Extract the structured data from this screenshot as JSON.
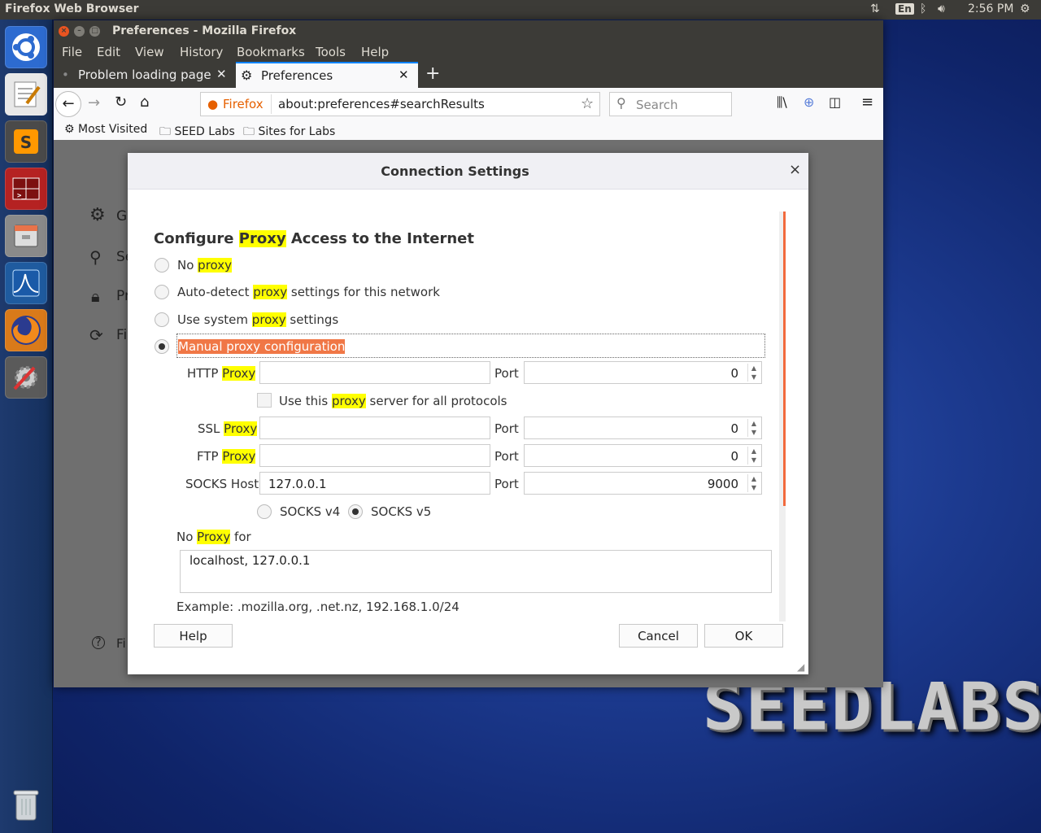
{
  "top_panel": {
    "title": "Firefox Web Browser",
    "keyboard_layout": "En",
    "time": "2:56 PM"
  },
  "launcher": {
    "items": [
      "files-app-icon",
      "text-editor-icon",
      "sublime-text-icon",
      "terminal-icon",
      "file-manager-icon",
      "wireshark-icon",
      "firefox-icon",
      "system-settings-icon"
    ],
    "trash_icon": "trash-icon"
  },
  "desktop": {
    "logo_text": "SEEDLABS"
  },
  "firefox": {
    "window_title": "Preferences - Mozilla Firefox",
    "menu": [
      "File",
      "Edit",
      "View",
      "History",
      "Bookmarks",
      "Tools",
      "Help"
    ],
    "tabs": [
      {
        "label": "Problem loading page"
      },
      {
        "label": "Preferences"
      }
    ],
    "url": {
      "identity": "Firefox",
      "value": "about:preferences#searchResults"
    },
    "search_placeholder": "Search",
    "bookmarks": [
      "Most Visited",
      "SEED Labs",
      "Sites for Labs"
    ],
    "sidebar_partial": [
      "Ge",
      "Se",
      "Pr",
      "Fi"
    ],
    "footer_partial": "Fi"
  },
  "dialog": {
    "title": "Connection Settings",
    "close": "×",
    "heading_pre": "Configure ",
    "heading_hl": "Proxy",
    "heading_post": " Access to the Internet",
    "options": {
      "no_proxy": {
        "pre": "No ",
        "hl": "proxy",
        "post": ""
      },
      "auto_detect": {
        "pre": "Auto-detect ",
        "hl": "proxy",
        "post": " settings for this network"
      },
      "system": {
        "pre": "Use system ",
        "hl": "proxy",
        "post": " settings"
      },
      "manual": "Manual proxy configuration"
    },
    "http": {
      "pre": "HTTP ",
      "hl": "Proxy",
      "value": "",
      "port_label": "Port",
      "port": "0"
    },
    "use_for_all": {
      "pre": "Use this ",
      "hl": "proxy",
      "post": " server for all protocols"
    },
    "ssl": {
      "pre": "SSL ",
      "hl": "Proxy",
      "value": "",
      "port_label": "Port",
      "port": "0"
    },
    "ftp": {
      "pre": "FTP ",
      "hl": "Proxy",
      "value": "",
      "port_label": "Port",
      "port": "0"
    },
    "socks": {
      "label": "SOCKS Host",
      "value": "127.0.0.1",
      "port_label": "Port",
      "port": "9000"
    },
    "socks_v4": "SOCKS v4",
    "socks_v5": "SOCKS v5",
    "no_proxy_for": {
      "pre": "No ",
      "hl": "Proxy",
      "post": " for"
    },
    "no_proxy_value": "localhost, 127.0.0.1",
    "example": "Example: .mozilla.org, .net.nz, 192.168.1.0/24",
    "buttons": {
      "help": "Help",
      "cancel": "Cancel",
      "ok": "OK"
    }
  }
}
